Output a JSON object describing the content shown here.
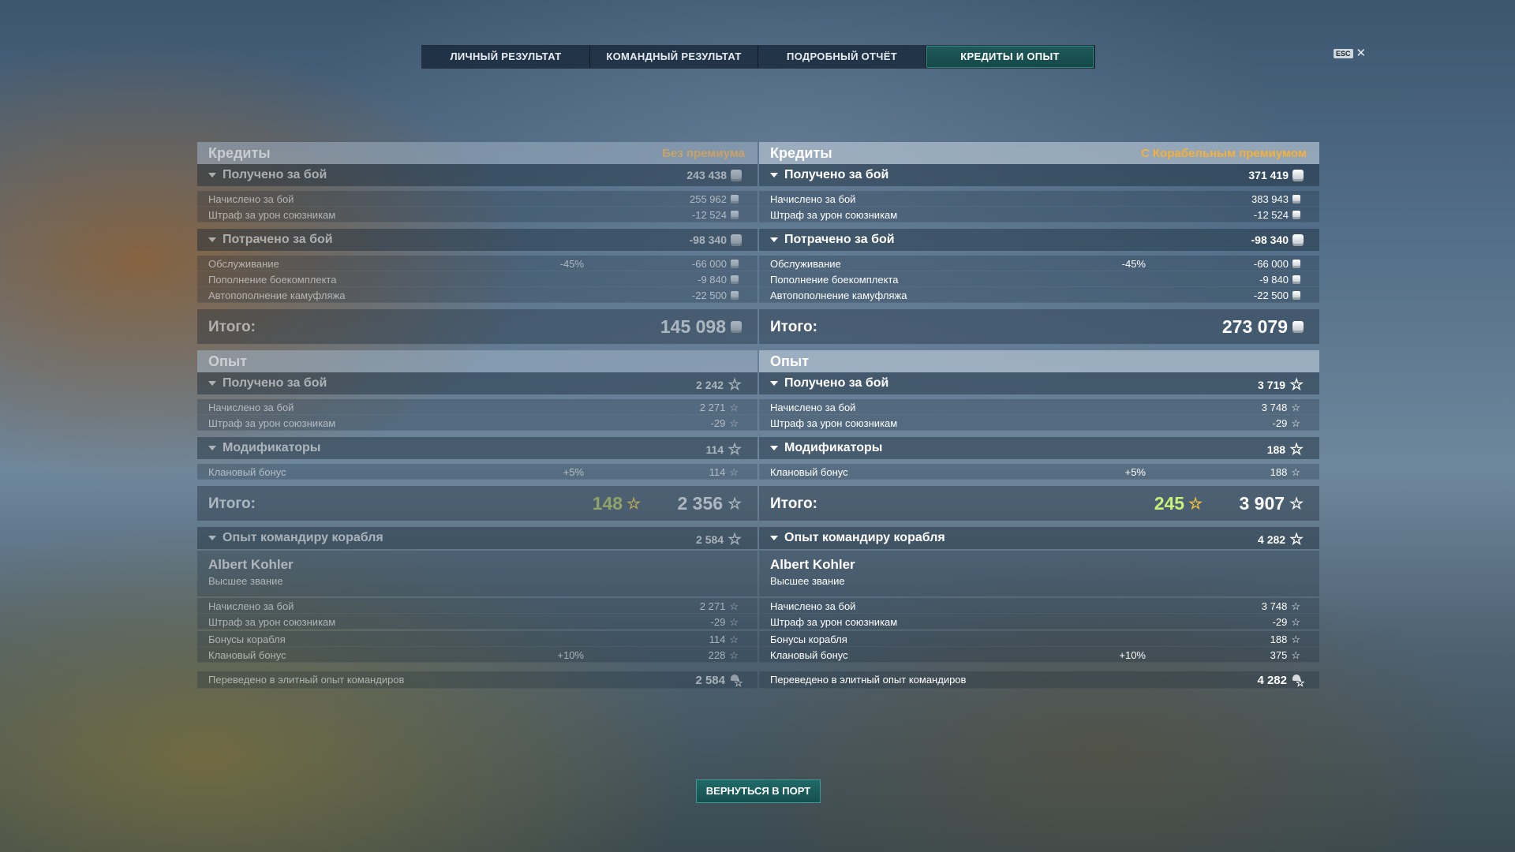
{
  "tabs": [
    "ЛИЧНЫЙ РЕЗУЛЬТАТ",
    "КОМАНДНЫЙ РЕЗУЛЬТАТ",
    "ПОДРОБНЫЙ ОТЧЁТ",
    "КРЕДИТЫ И ОПЫТ"
  ],
  "active_tab": "КРЕДИТЫ И ОПЫТ",
  "esc_label": "ESC",
  "close_glyph": "✕",
  "colors": {
    "premium_accent": "#f5b03a",
    "xp_bonus": "#c8f07a",
    "active_tab": "#1f5a5a"
  },
  "icons": {
    "credits": "credit-coin-icon",
    "xp": "star-icon",
    "elite_xp": "elite-commander-xp-icon"
  },
  "left": {
    "credits_title": "Кредиты",
    "mode": "Без премиума",
    "earned": {
      "label": "Получено за бой",
      "value": "243 438",
      "items": [
        {
          "label": "Начислено за бой",
          "value": "255 962"
        },
        {
          "label": "Штраф за урон союзникам",
          "value": "-12 524"
        }
      ]
    },
    "spent": {
      "label": "Потрачено за бой",
      "value": "-98 340",
      "items": [
        {
          "label": "Обслуживание",
          "pct": "-45%",
          "value": "-66 000"
        },
        {
          "label": "Пополнение боекомплекта",
          "value": "-9 840"
        },
        {
          "label": "Автопополнение камуфляжа",
          "value": "-22 500"
        }
      ]
    },
    "credits_total": {
      "label": "Итого:",
      "value": "145 098"
    },
    "xp_title": "Опыт",
    "xp_earned": {
      "label": "Получено за бой",
      "value": "2 242",
      "items": [
        {
          "label": "Начислено за бой",
          "value": "2 271"
        },
        {
          "label": "Штраф за урон союзникам",
          "value": "-29"
        }
      ]
    },
    "modifiers": {
      "label": "Модификаторы",
      "value": "114",
      "items": [
        {
          "label": "Клановый бонус",
          "pct": "+5%",
          "value": "114"
        }
      ]
    },
    "xp_total": {
      "label": "Итого:",
      "free_xp": "148",
      "value": "2 356"
    },
    "commander": {
      "label": "Опыт командиру корабля",
      "value": "2 584",
      "name": "Albert Kohler",
      "rank": "Высшее звание",
      "items": [
        {
          "label": "Начислено за бой",
          "value": "2 271"
        },
        {
          "label": "Штраф за урон союзникам",
          "value": "-29"
        },
        {
          "label": "Бонусы корабля",
          "value": "114"
        },
        {
          "label": "Клановый бонус",
          "pct": "+10%",
          "value": "228"
        }
      ],
      "elite_label": "Переведено в элитный опыт командиров",
      "elite_value": "2 584"
    }
  },
  "right": {
    "credits_title": "Кредиты",
    "mode": "С Корабельным премиумом",
    "earned": {
      "label": "Получено за бой",
      "value": "371 419",
      "items": [
        {
          "label": "Начислено за бой",
          "value": "383 943"
        },
        {
          "label": "Штраф за урон союзникам",
          "value": "-12 524"
        }
      ]
    },
    "spent": {
      "label": "Потрачено за бой",
      "value": "-98 340",
      "items": [
        {
          "label": "Обслуживание",
          "pct": "-45%",
          "value": "-66 000"
        },
        {
          "label": "Пополнение боекомплекта",
          "value": "-9 840"
        },
        {
          "label": "Автопополнение камуфляжа",
          "value": "-22 500"
        }
      ]
    },
    "credits_total": {
      "label": "Итого:",
      "value": "273 079"
    },
    "xp_title": "Опыт",
    "xp_earned": {
      "label": "Получено за бой",
      "value": "3 719",
      "items": [
        {
          "label": "Начислено за бой",
          "value": "3 748"
        },
        {
          "label": "Штраф за урон союзникам",
          "value": "-29"
        }
      ]
    },
    "modifiers": {
      "label": "Модификаторы",
      "value": "188",
      "items": [
        {
          "label": "Клановый бонус",
          "pct": "+5%",
          "value": "188"
        }
      ]
    },
    "xp_total": {
      "label": "Итого:",
      "free_xp": "245",
      "value": "3 907"
    },
    "commander": {
      "label": "Опыт командиру корабля",
      "value": "4 282",
      "name": "Albert Kohler",
      "rank": "Высшее звание",
      "items": [
        {
          "label": "Начислено за бой",
          "value": "3 748"
        },
        {
          "label": "Штраф за урон союзникам",
          "value": "-29"
        },
        {
          "label": "Бонусы корабля",
          "value": "188"
        },
        {
          "label": "Клановый бонус",
          "pct": "+10%",
          "value": "375"
        }
      ],
      "elite_label": "Переведено в элитный опыт командиров",
      "elite_value": "4 282"
    }
  },
  "return_button": "ВЕРНУТЬСЯ В ПОРТ"
}
